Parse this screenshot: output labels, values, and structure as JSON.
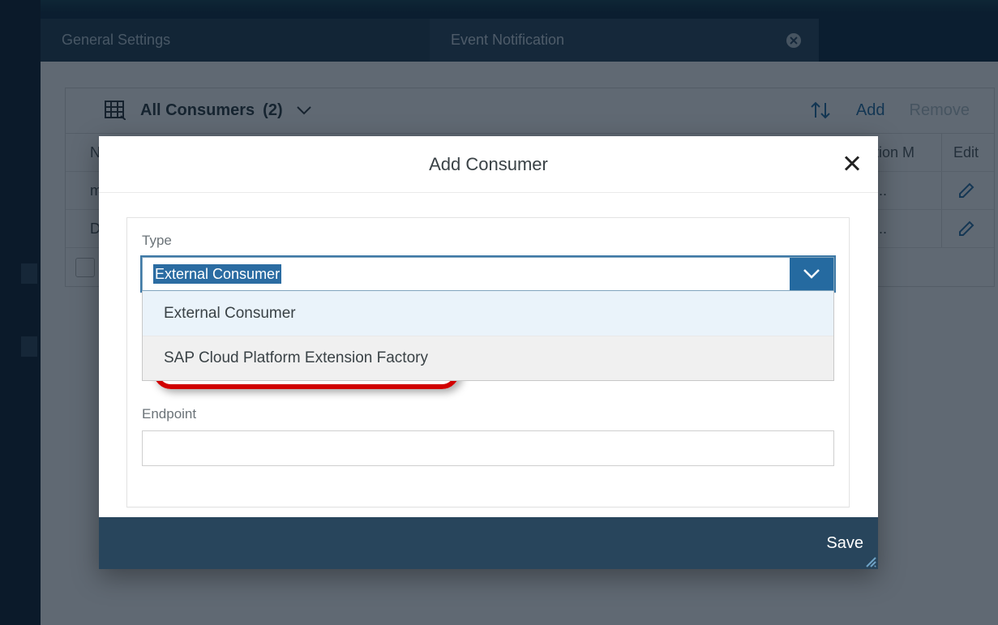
{
  "tabs": {
    "general": "General Settings",
    "event": "Event Notification"
  },
  "consumers_header": {
    "title": "All Consumers",
    "count": "(2)"
  },
  "actions": {
    "add": "Add",
    "remove": "Remove"
  },
  "columns": {
    "name": "Na",
    "auth": "ntication M",
    "edit": "Edit"
  },
  "rows": [
    {
      "name": "my",
      "auth": "lient ..."
    },
    {
      "name": "De",
      "auth": "lient ..."
    }
  ],
  "modal": {
    "title": "Add Consumer",
    "type_label": "Type",
    "type_value": "External Consumer",
    "options": [
      "External Consumer",
      "SAP Cloud Platform Extension Factory"
    ],
    "endpoint_label": "Endpoint",
    "endpoint_value": "",
    "save": "Save"
  }
}
